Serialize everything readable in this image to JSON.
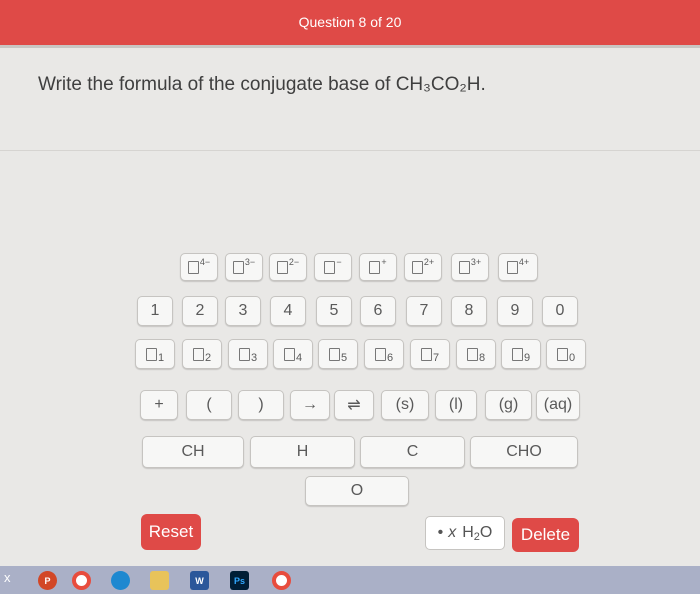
{
  "header": {
    "question_counter": "Question 8 of 20"
  },
  "prompt": {
    "text": "Write the formula of the conjugate base of CH₃CO₂H."
  },
  "charge_keys": [
    {
      "sup": "4−"
    },
    {
      "sup": "3−"
    },
    {
      "sup": "2−"
    },
    {
      "sup": "−"
    },
    {
      "sup": "+"
    },
    {
      "sup": "2+"
    },
    {
      "sup": "3+"
    },
    {
      "sup": "4+"
    }
  ],
  "number_keys": [
    "1",
    "2",
    "3",
    "4",
    "5",
    "6",
    "7",
    "8",
    "9",
    "0"
  ],
  "subscript_keys": [
    "1",
    "2",
    "3",
    "4",
    "5",
    "6",
    "7",
    "8",
    "9",
    "0"
  ],
  "symbol_keys": [
    "+",
    "(",
    ")",
    "→",
    "⇌",
    "(s)",
    "(l)",
    "(g)",
    "(aq)"
  ],
  "element_keys": [
    "CH",
    "H",
    "C",
    "CHO"
  ],
  "element_key_o": "O",
  "actions": {
    "reset": "Reset",
    "water_dot": "•",
    "water_x": "x",
    "water_h": "H",
    "water_sub": "2",
    "water_o": "O",
    "delete": "Delete"
  },
  "taskbar": {
    "left_label": "x",
    "icons": [
      "P",
      "W",
      "Ps"
    ]
  },
  "colors": {
    "accent": "#df4a47",
    "taskbar": "#aab0c7"
  }
}
